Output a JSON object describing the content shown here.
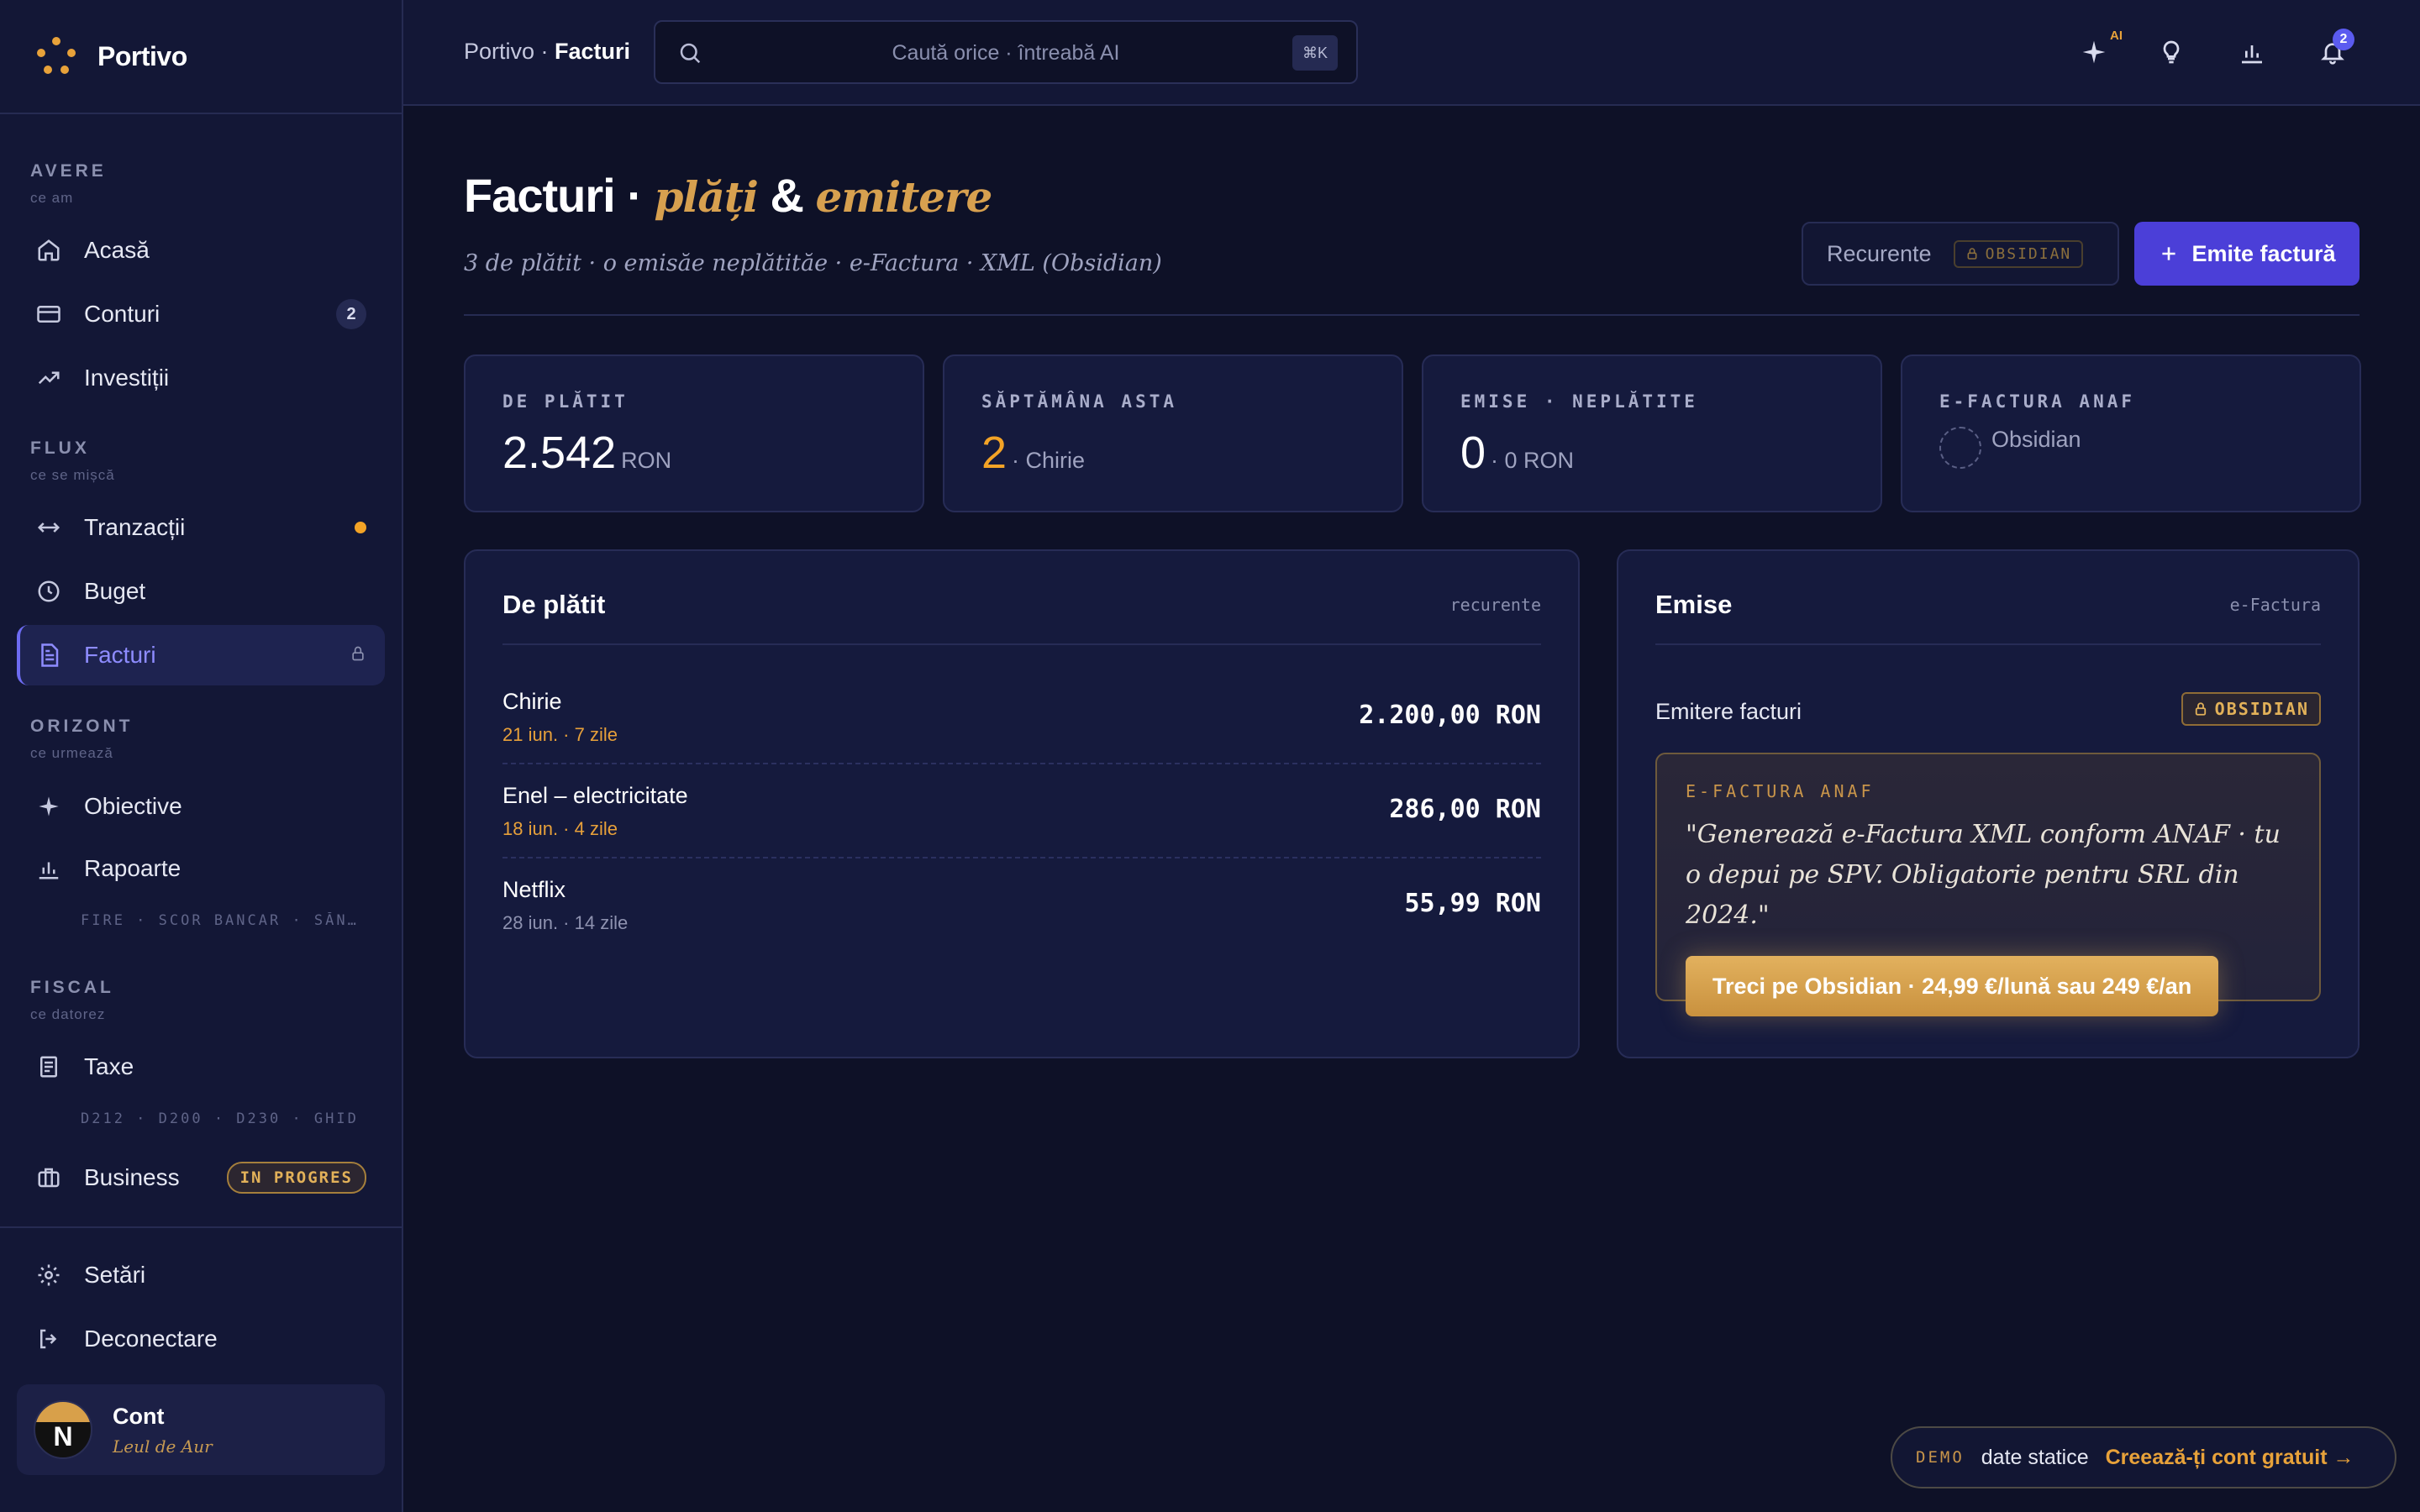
{
  "brand": {
    "name": "Portivo"
  },
  "sidebar": {
    "sections": [
      {
        "label": "AVERE",
        "sub": "ce am"
      },
      {
        "label": "FLUX",
        "sub": "ce se mișcă"
      },
      {
        "label": "ORIZONT",
        "sub": "ce urmează"
      },
      {
        "label": "FISCAL",
        "sub": "ce datorez"
      }
    ],
    "items": {
      "acasa": "Acasă",
      "conturi": "Conturi",
      "conturi_count": "2",
      "investitii": "Investiții",
      "tranzactii": "Tranzacții",
      "buget": "Buget",
      "facturi": "Facturi",
      "obiective": "Obiective",
      "rapoarte": "Rapoarte",
      "rapoarte_sub": "FIRE · SCOR BANCAR · SĂNĂTATE",
      "taxe": "Taxe",
      "taxe_sub": "D212 · D200 · D230 · GHID",
      "business": "Business",
      "business_badge": "IN PROGRES",
      "setari": "Setări",
      "deconectare": "Deconectare"
    },
    "account": {
      "name": "Cont",
      "sub": "Leul de Aur",
      "initial": "N"
    }
  },
  "topbar": {
    "crumb_root": "Portivo · ",
    "crumb_current": "Facturi",
    "search_placeholder": "Caută orice · întreabă AI",
    "shortcut": "⌘K",
    "ai_label": "AI",
    "notifications": "2"
  },
  "page": {
    "title_main": "Facturi · ",
    "title_accent1": "plăți",
    "title_amp": " & ",
    "title_accent2": "emitere",
    "subtitle": "3 de plătit · o emisăe neplătităe · e-Factura · XML (Obsidian)",
    "btn_recurente": "Recurente",
    "lock_label": "OBSIDIAN",
    "btn_emite": "Emite factură"
  },
  "stats": [
    {
      "label": "DE PLĂTIT",
      "big": "2.542",
      "small": "RON"
    },
    {
      "label": "SĂPTĂMÂNA ASTA",
      "big": "2",
      "small": "· Chirie"
    },
    {
      "label": "EMISE · NEPLĂTITE",
      "big": "0",
      "small": "· 0 RON"
    },
    {
      "label": "E-FACTURA ANAF",
      "small": "Obsidian"
    }
  ],
  "to_pay": {
    "title": "De plătit",
    "tag": "recurente",
    "bills": [
      {
        "name": "Chirie",
        "date": "21 iun. · 7 zile",
        "amount": "2.200,00 RON"
      },
      {
        "name": "Enel – electricitate",
        "date": "18 iun. · 4 zile",
        "amount": "286,00 RON"
      },
      {
        "name": "Netflix",
        "date": "28 iun. · 14 zile",
        "amount": "55,99 RON"
      }
    ]
  },
  "issued": {
    "title": "Emise",
    "tag": "e-Factura",
    "row_label": "Emitere facturi",
    "lock_label": "OBSIDIAN",
    "promo_label": "E-FACTURA ANAF",
    "promo_quote": "\"Generează e-Factura XML conform ANAF · tu o depui pe SPV. Obligatorie pentru SRL din 2024.\"",
    "promo_button": "Treci pe Obsidian · 24,99 €/lună sau 249 €/an"
  },
  "demo": {
    "tag": "DEMO",
    "text": "date statice",
    "cta": "Creează-ți cont gratuit →"
  },
  "colors": {
    "accent": "#4b3fd8",
    "gold": "#d7a04f",
    "orange": "#f3a326",
    "bg": "#0e1127"
  }
}
